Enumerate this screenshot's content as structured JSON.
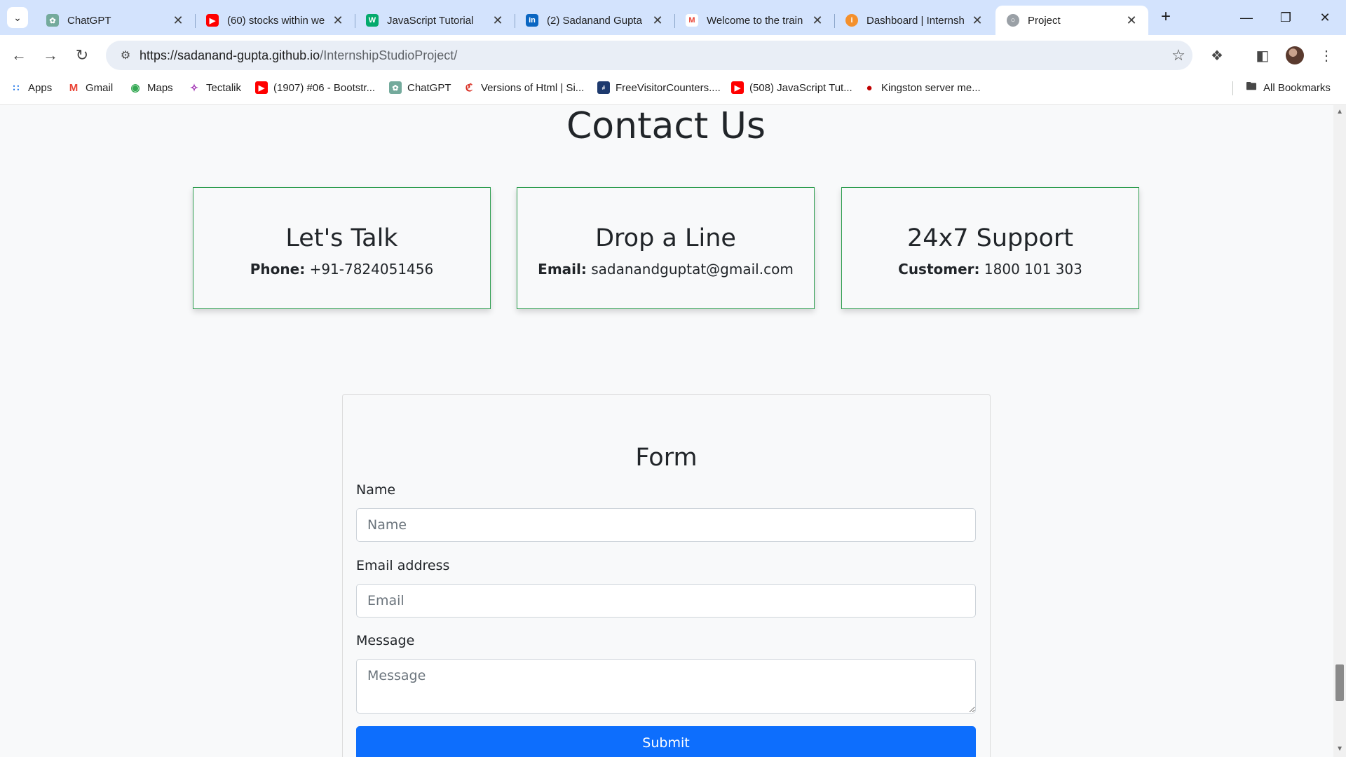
{
  "browser": {
    "tabs": [
      {
        "title": "ChatGPT",
        "icon": "chatgpt-icon",
        "color": "#74aa9c"
      },
      {
        "title": "(60) stocks within we",
        "icon": "youtube-icon",
        "color": "#ff0000"
      },
      {
        "title": "JavaScript Tutorial",
        "icon": "w3schools-icon",
        "color": "#04aa6d"
      },
      {
        "title": "(2) Sadanand Gupta",
        "icon": "linkedin-icon",
        "color": "#0a66c2"
      },
      {
        "title": "Welcome to the train",
        "icon": "gmail-icon",
        "color": "#ea4335"
      },
      {
        "title": "Dashboard | Internsh",
        "icon": "internshala-icon",
        "color": "#f4902c"
      },
      {
        "title": "Project",
        "icon": "globe-icon",
        "color": "#9aa0a6",
        "active": true
      }
    ],
    "url_host": "https://sadanand-gupta.github.io",
    "url_path": "/InternshipStudioProject/",
    "bookmarks": [
      {
        "label": "Apps",
        "icon": "apps-grid-icon",
        "color": "#1a73e8"
      },
      {
        "label": "Gmail",
        "icon": "gmail-icon",
        "color": "#ea4335"
      },
      {
        "label": "Maps",
        "icon": "maps-pin-icon",
        "color": "#34a853"
      },
      {
        "label": "Tectalik",
        "icon": "tectalik-icon",
        "color": "#9c27b0"
      },
      {
        "label": "(1907) #06 - Bootstr...",
        "icon": "youtube-icon",
        "color": "#ff0000"
      },
      {
        "label": "ChatGPT",
        "icon": "chatgpt-icon",
        "color": "#74aa9c"
      },
      {
        "label": "Versions of Html | Si...",
        "icon": "site-icon",
        "color": "#d93025"
      },
      {
        "label": "FreeVisitorCounters....",
        "icon": "counter-icon",
        "color": "#1e3a6e"
      },
      {
        "label": "(508) JavaScript Tut...",
        "icon": "youtube-icon",
        "color": "#ff0000"
      },
      {
        "label": "Kingston server me...",
        "icon": "kingston-icon",
        "color": "#c00000"
      }
    ],
    "all_bookmarks": "All Bookmarks"
  },
  "page": {
    "heading": "Contact Us",
    "cards": [
      {
        "title": "Let's Talk",
        "key": "Phone:",
        "value": "+91-7824051456"
      },
      {
        "title": "Drop a Line",
        "key": "Email:",
        "value": "sadanandguptat@gmail.com"
      },
      {
        "title": "24x7 Support",
        "key": "Customer:",
        "value": "1800 101 303"
      }
    ],
    "form": {
      "title": "Form",
      "name_label": "Name",
      "name_placeholder": "Name",
      "email_label": "Email address",
      "email_placeholder": "Email",
      "message_label": "Message",
      "message_placeholder": "Message",
      "submit_label": "Submit"
    }
  },
  "colors": {
    "card_border": "#2e9e4f",
    "submit_bg": "#0d6efd",
    "tabstrip_bg": "#d3e3fd"
  }
}
